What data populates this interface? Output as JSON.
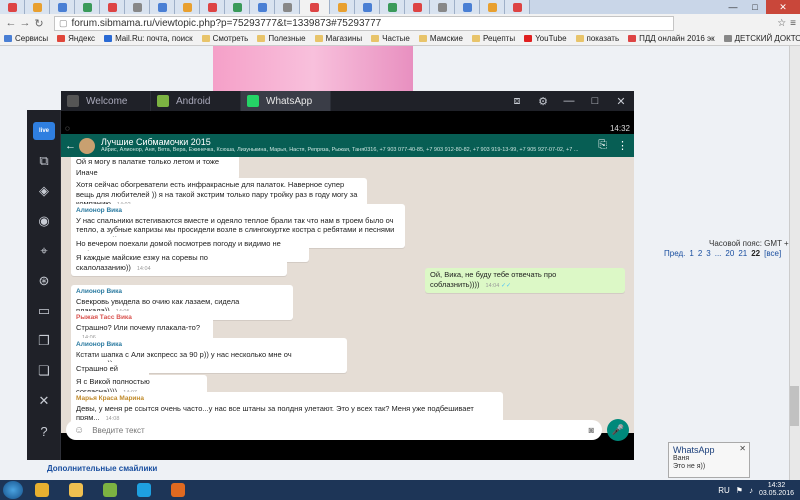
{
  "browser": {
    "url": "forum.sibmama.ru/viewtopic.php?p=75293777&t=1339873#75293777",
    "bookmarks": [
      {
        "label": "Сервисы",
        "color": "#4a7fd4"
      },
      {
        "label": "Яндекс",
        "color": "#e0463a"
      },
      {
        "label": "Mail.Ru: почта, поиск",
        "color": "#2a6ad4"
      },
      {
        "label": "Смотреть",
        "color": "#e8c46a"
      },
      {
        "label": "Полезные",
        "color": "#e8c46a"
      },
      {
        "label": "Магазины",
        "color": "#e8c46a"
      },
      {
        "label": "Частые",
        "color": "#e8c46a"
      },
      {
        "label": "Мамские",
        "color": "#e8c46a"
      },
      {
        "label": "Рецепты",
        "color": "#e8c46a"
      },
      {
        "label": "YouTube",
        "color": "#e02020"
      },
      {
        "label": "показать",
        "color": "#e8c46a"
      },
      {
        "label": "ПДД онлайн 2016 эк",
        "color": "#d44"
      },
      {
        "label": "ДЕТСКИЙ ДОКТОР",
        "color": "#888"
      }
    ]
  },
  "page_bg": {
    "tz_label": "Часовой пояс: GMT + 6",
    "pager": [
      "Пред.",
      "1",
      "2",
      "3",
      "...",
      "20",
      "21",
      "22",
      "[все]"
    ],
    "footer_link": "Дополнительные смайлики"
  },
  "app": {
    "tabs": [
      {
        "label": "Welcome",
        "color": "#555"
      },
      {
        "label": "Android",
        "color": "#7cb342"
      },
      {
        "label": "WhatsApp",
        "color": "#25d366"
      }
    ],
    "status_time": "14:32",
    "chat_title": "Лучшие Сибмамочки 2015",
    "chat_members": "Айрис, Алионор, Аня, Вета, Вера, Ежинечка, Ксюша, Лизунькина, Марья, Настя, Репряза, Рыжая, Таня0316, +7 903 077-40-85, +7 903 912-80-82, +7 903 919-13-99, +7 905 927-07-02, +7 ...",
    "input_placeholder": "Введите текст"
  },
  "messages": [
    {
      "sender": "",
      "text": "Ой я могу в палатке только летом и тоже за",
      "time": "14:03",
      "out": false
    },
    {
      "sender": "",
      "text": "Иначе мёрзну",
      "time": "14:03",
      "out": false
    },
    {
      "sender": "",
      "text": "Хотя сейчас обогреватели есть инфракрасные для палаток. Наверное супер вещь для любителей )) я на такой экстрим только пару тройку раз в году могу за компанию",
      "time": "14:02",
      "out": false
    },
    {
      "sender": "Алионор Вика",
      "text": "У нас спальники встегиваются вместе и одеяло теплое брали так что нам в троем было оч тепло, а зубные капризы мы просидели возле в слингокуртке костра с ребятами и песнями под гитару))",
      "time": "14:02",
      "out": false
    },
    {
      "sender": "",
      "text": "Но вечером поехали домой посмотрев погоду и видимо не зря)",
      "time": "14:03",
      "out": false
    },
    {
      "sender": "",
      "text": "Я каждые майские езжу на соревы по скалолазанию))",
      "time": "14:04",
      "out": false
    },
    {
      "sender": "",
      "text": "Ой, Вика, не буду тебе отвечать про соблазнить))))",
      "time": "14:04",
      "out": true
    },
    {
      "sender": "Алионор Вика",
      "text": "Свекровь увидела во очию как лазаем, сидела плакала))",
      "time": "14:05",
      "out": false
    },
    {
      "sender": "Рыжая Тасс Вика",
      "text": "Страшно? Или почему плакала-то?",
      "time": "14:06",
      "out": false
    },
    {
      "sender": "Алионор Вика",
      "text": "Кстати шапка с Али экспресс за 90 р)) у нас несколько мне оч нравятся))",
      "time": "14:06",
      "out": false
    },
    {
      "sender": "",
      "text": "Страшно ей было))",
      "time": "14:06",
      "out": false
    },
    {
      "sender": "",
      "text": "Я с Викой полностью согласна))))",
      "time": "14:07",
      "out": false
    },
    {
      "sender": "Марья Краса Марина",
      "text": "Девы, у меня ре ссытся очень часто...у нас все штаны за полдня улетают. Это у всех так? Меня уже подбешивает прям...",
      "time": "14:08",
      "out": false
    }
  ],
  "notification": {
    "title": "WhatsApp",
    "line1": "Ваня",
    "line2": "Это не я))"
  },
  "taskbar": {
    "lang": "RU",
    "time": "14:32",
    "date": "03.05.2016",
    "apps": [
      {
        "name": "chrome",
        "color": "#e8b030"
      },
      {
        "name": "explorer",
        "color": "#f0c050"
      },
      {
        "name": "bluestacks",
        "color": "#7cb342"
      },
      {
        "name": "skype",
        "color": "#1ea0e0"
      },
      {
        "name": "media",
        "color": "#e06a20"
      }
    ]
  },
  "colors": {
    "wa_header": "#075e54",
    "wa_chat_bg": "#e5ddd5",
    "wa_outgoing": "#dcf8c6"
  }
}
